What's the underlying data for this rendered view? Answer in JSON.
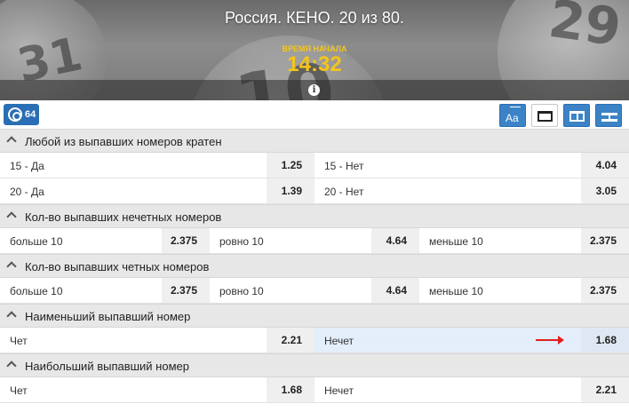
{
  "header": {
    "title": "Россия. КЕНО. 20 из 80.",
    "start_label": "ВРЕМЯ НАЧАЛА",
    "start_time": "14:32",
    "background_numbers": [
      "31",
      "10",
      "29"
    ],
    "accent_color": "#f5c518"
  },
  "toolbar": {
    "markets_count": "64",
    "count_icon": "target-icon",
    "view_buttons": [
      {
        "icon": "font-size-icon",
        "label": "Aa"
      },
      {
        "icon": "single-column-icon"
      },
      {
        "icon": "two-column-icon"
      },
      {
        "icon": "pin-icon"
      }
    ]
  },
  "markets": [
    {
      "title": "Любой из выпавших номеров кратен",
      "rows": [
        [
          {
            "label": "15 - Да",
            "odd": "1.25"
          },
          {
            "label": "15 - Нет",
            "odd": "4.04"
          }
        ],
        [
          {
            "label": "20 - Да",
            "odd": "1.39"
          },
          {
            "label": "20 - Нет",
            "odd": "3.05"
          }
        ]
      ]
    },
    {
      "title": "Кол-во выпавших нечетных номеров",
      "rows": [
        [
          {
            "label": "больше 10",
            "odd": "2.375"
          },
          {
            "label": "ровно 10",
            "odd": "4.64"
          },
          {
            "label": "меньше 10",
            "odd": "2.375"
          }
        ]
      ]
    },
    {
      "title": "Кол-во выпавших четных номеров",
      "rows": [
        [
          {
            "label": "больше 10",
            "odd": "2.375"
          },
          {
            "label": "ровно 10",
            "odd": "4.64"
          },
          {
            "label": "меньше 10",
            "odd": "2.375"
          }
        ]
      ]
    },
    {
      "title": "Наименьший выпавший номер",
      "rows": [
        [
          {
            "label": "Чет",
            "odd": "2.21"
          },
          {
            "label": "Нечет",
            "odd": "1.68",
            "highlighted": true
          }
        ]
      ]
    },
    {
      "title": "Наибольший выпавший номер",
      "rows": [
        [
          {
            "label": "Чет",
            "odd": "1.68"
          },
          {
            "label": "Нечет",
            "odd": "2.21"
          }
        ]
      ]
    }
  ]
}
